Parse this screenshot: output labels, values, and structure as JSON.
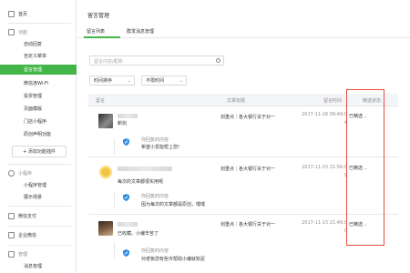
{
  "sidebar": {
    "home": "首页",
    "features": "功能",
    "auto_reply": "自动回复",
    "custom_menu": "自定义菜单",
    "comment_mgmt": "留言管理",
    "wifi": "微信连Wi-Fi",
    "vote_mgmt": "投票管理",
    "pages_template": "页面模版",
    "store_miniprogram": "门店小程序",
    "original_declaration": "原创声明功能",
    "add_plugin": "+ 添加功能插件",
    "miniprogram": "小程序",
    "miniprogram_mgmt": "小程序管理",
    "showcase": "展示场景",
    "wechat_pay": "微信支付",
    "enterprise_wechat": "企业微信",
    "manage": "管理",
    "message_mgmt": "消息管理"
  },
  "main": {
    "title": "留言管理",
    "tabs": [
      "留言列表",
      "群发消息管理"
    ],
    "search_placeholder": "留言内容/昵称",
    "sort_label": "时间排序",
    "time_filter_label": "不限时间",
    "columns": [
      "留言",
      "文章标题",
      "留言时间",
      "精选状态"
    ]
  },
  "rows": [
    {
      "name": "断剑",
      "message": "断剑",
      "article": "划重点｜各大银行关于对一",
      "time_line1": "2017-11-16 09:49:0",
      "time_line2": "4",
      "status": "已精选",
      "reply_label": "你回复的内容",
      "reply": "希望小爱能帮上您!"
    },
    {
      "name": "",
      "message": "每次的文章都很实用呢",
      "article": "划重点｜各大银行关于对一",
      "time_line1": "2017-11-15 21:56:0",
      "time_line2": "9",
      "status": "已精选",
      "reply_label": "你回复的内容",
      "reply": "因为每次的文章都是原创，嘿嘿"
    },
    {
      "name": "",
      "message": "已收藏。小编辛苦了",
      "article": "划重点｜各大银行关于对一",
      "time_line1": "2017-11-15 21:49:0",
      "time_line2": "0",
      "status": "已精选",
      "reply_label": "你回复的内容",
      "reply": "对老板您有些许帮助小编就知足"
    }
  ],
  "colors": {
    "accent": "#44b549",
    "highlight": "#e74c3c"
  }
}
